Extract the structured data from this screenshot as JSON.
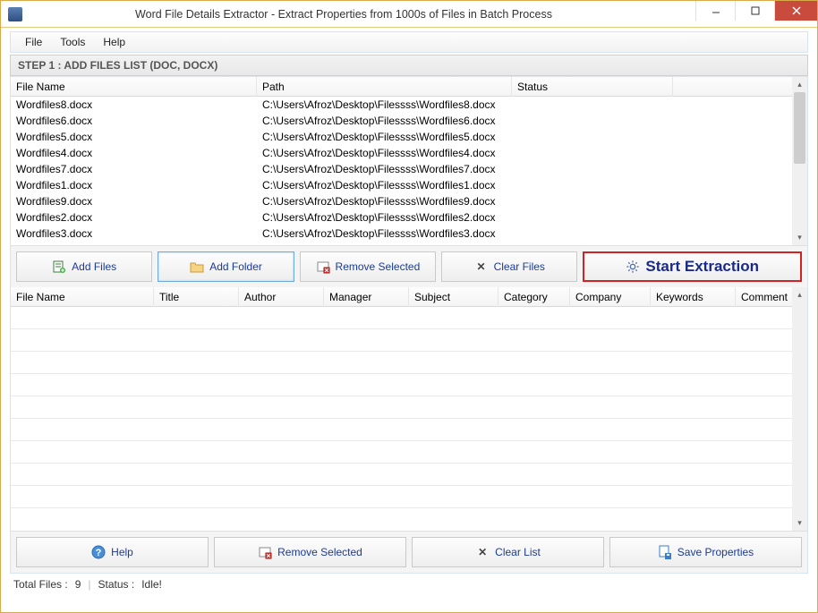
{
  "window": {
    "title": "Word File Details Extractor - Extract Properties from 1000s of Files in Batch Process"
  },
  "menu": {
    "file": "File",
    "tools": "Tools",
    "help": "Help"
  },
  "step_header": "STEP 1 : ADD FILES LIST (DOC, DOCX)",
  "list1": {
    "columns": {
      "filename": "File Name",
      "path": "Path",
      "status": "Status"
    },
    "rows": [
      {
        "filename": "Wordfiles8.docx",
        "path": "C:\\Users\\Afroz\\Desktop\\Filessss\\Wordfiles8.docx",
        "status": ""
      },
      {
        "filename": "Wordfiles6.docx",
        "path": "C:\\Users\\Afroz\\Desktop\\Filessss\\Wordfiles6.docx",
        "status": ""
      },
      {
        "filename": "Wordfiles5.docx",
        "path": "C:\\Users\\Afroz\\Desktop\\Filessss\\Wordfiles5.docx",
        "status": ""
      },
      {
        "filename": "Wordfiles4.docx",
        "path": "C:\\Users\\Afroz\\Desktop\\Filessss\\Wordfiles4.docx",
        "status": ""
      },
      {
        "filename": "Wordfiles7.docx",
        "path": "C:\\Users\\Afroz\\Desktop\\Filessss\\Wordfiles7.docx",
        "status": ""
      },
      {
        "filename": "Wordfiles1.docx",
        "path": "C:\\Users\\Afroz\\Desktop\\Filessss\\Wordfiles1.docx",
        "status": ""
      },
      {
        "filename": "Wordfiles9.docx",
        "path": "C:\\Users\\Afroz\\Desktop\\Filessss\\Wordfiles9.docx",
        "status": ""
      },
      {
        "filename": "Wordfiles2.docx",
        "path": "C:\\Users\\Afroz\\Desktop\\Filessss\\Wordfiles2.docx",
        "status": ""
      },
      {
        "filename": "Wordfiles3.docx",
        "path": "C:\\Users\\Afroz\\Desktop\\Filessss\\Wordfiles3.docx",
        "status": ""
      }
    ]
  },
  "buttons_top": {
    "add_files": "Add Files",
    "add_folder": "Add Folder",
    "remove_selected": "Remove Selected",
    "clear_files": "Clear Files",
    "start": "Start Extraction"
  },
  "list2": {
    "columns": {
      "filename": "File Name",
      "title": "Title",
      "author": "Author",
      "manager": "Manager",
      "subject": "Subject",
      "category": "Category",
      "company": "Company",
      "keywords": "Keywords",
      "comment": "Comment"
    }
  },
  "buttons_bottom": {
    "help": "Help",
    "remove_selected": "Remove Selected",
    "clear_list": "Clear List",
    "save_properties": "Save Properties"
  },
  "status": {
    "total_files_label": "Total Files :",
    "total_files_value": "9",
    "status_label": "Status :",
    "status_value": "Idle!"
  }
}
